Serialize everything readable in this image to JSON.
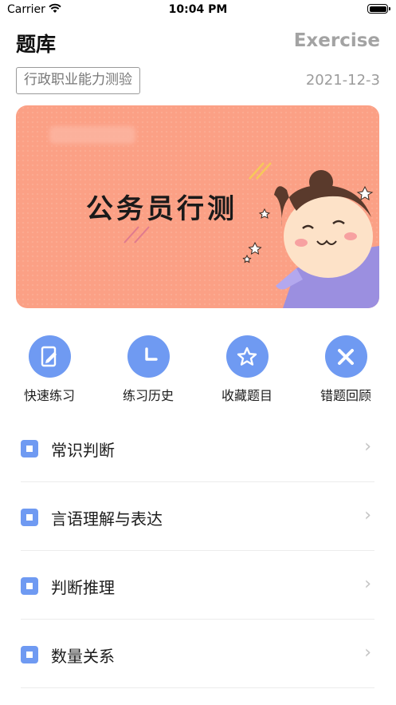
{
  "status_bar": {
    "carrier": "Carrier",
    "time": "10:04 PM"
  },
  "header": {
    "title": "题库",
    "subtitle": "Exercise"
  },
  "exam": {
    "tag": "行政职业能力测验",
    "date": "2021-12-3"
  },
  "banner": {
    "text": "公务员行测"
  },
  "quick_actions": [
    {
      "label": "快速练习",
      "icon": "edit-document-icon"
    },
    {
      "label": "练习历史",
      "icon": "clock-icon"
    },
    {
      "label": "收藏题目",
      "icon": "star-icon"
    },
    {
      "label": "错题回顾",
      "icon": "close-icon"
    }
  ],
  "categories": [
    {
      "label": "常识判断"
    },
    {
      "label": "言语理解与表达"
    },
    {
      "label": "判断推理"
    },
    {
      "label": "数量关系"
    }
  ],
  "colors": {
    "accent": "#6f9af2",
    "banner": "#fba085"
  }
}
